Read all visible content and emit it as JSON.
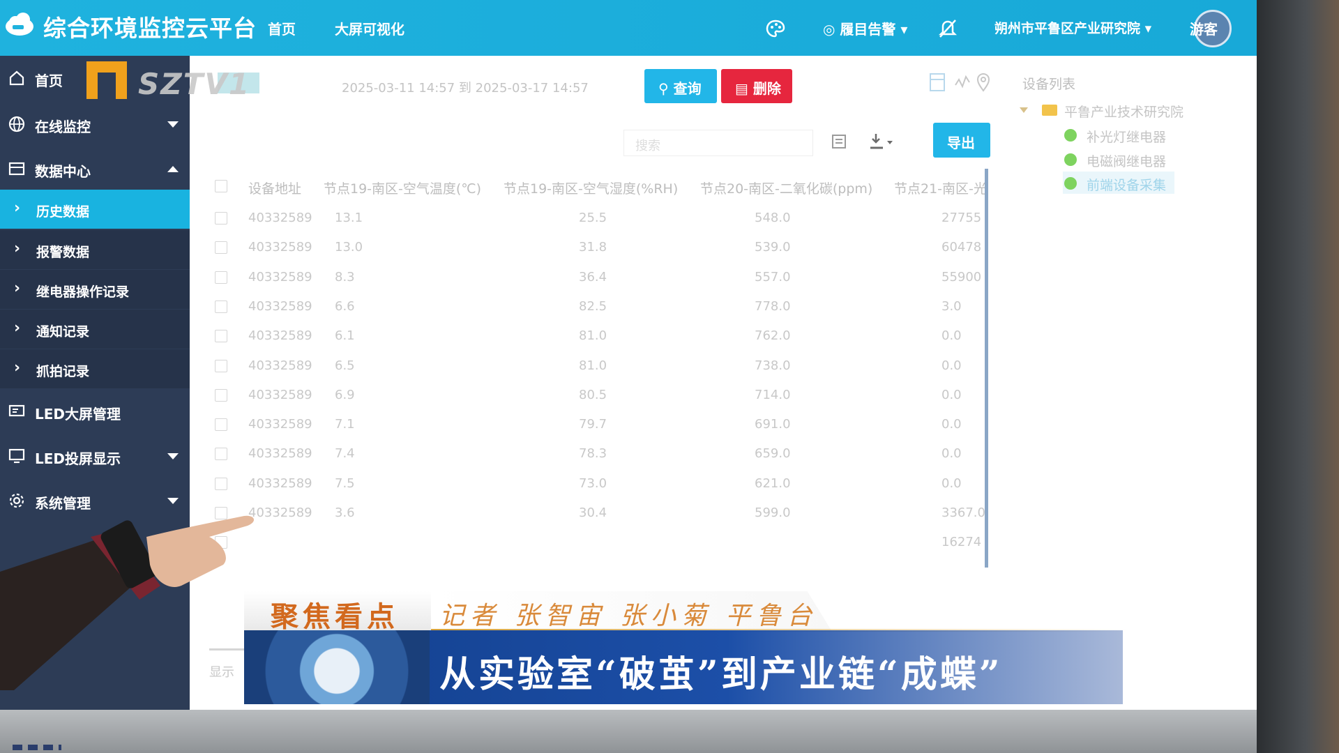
{
  "app": {
    "title": "综合环境监控云平台"
  },
  "topnav": {
    "home": "首页",
    "bigscreen": "大屏可视化",
    "alarm": "履目告警",
    "org": "朔州市平鲁区产业研究院",
    "user": "游客"
  },
  "sidebar": {
    "items": [
      {
        "label": "首页"
      },
      {
        "label": "在线监控"
      },
      {
        "label": "数据中心"
      },
      {
        "label": "LED大屏管理"
      },
      {
        "label": "LED投屏显示"
      },
      {
        "label": "系统管理"
      }
    ],
    "sub": [
      {
        "label": "历史数据"
      },
      {
        "label": "报警数据"
      },
      {
        "label": "继电器操作记录"
      },
      {
        "label": "通知记录"
      },
      {
        "label": "抓拍记录"
      }
    ]
  },
  "watermark": {
    "text": "SZTV1"
  },
  "toolbar": {
    "date_range": "2025-03-11 14:57 到 2025-03-17 14:57",
    "query": "查询",
    "delete": "删除",
    "search_placeholder": "搜索",
    "export": "导出"
  },
  "table": {
    "headers": [
      "设备地址",
      "节点19-南区-空气温度(℃)",
      "节点19-南区-空气湿度(%RH)",
      "节点20-南区-二氧化碳(ppm)",
      "节点21-南区-光"
    ],
    "rows": [
      [
        "40332589",
        "13.1",
        "25.5",
        "548.0",
        "27755"
      ],
      [
        "40332589",
        "13.0",
        "31.8",
        "539.0",
        "60478"
      ],
      [
        "40332589",
        "8.3",
        "36.4",
        "557.0",
        "55900"
      ],
      [
        "40332589",
        "6.6",
        "82.5",
        "778.0",
        "3.0"
      ],
      [
        "40332589",
        "6.1",
        "81.0",
        "762.0",
        "0.0"
      ],
      [
        "40332589",
        "6.5",
        "81.0",
        "738.0",
        "0.0"
      ],
      [
        "40332589",
        "6.9",
        "80.5",
        "714.0",
        "0.0"
      ],
      [
        "40332589",
        "7.1",
        "79.7",
        "691.0",
        "0.0"
      ],
      [
        "40332589",
        "7.4",
        "78.3",
        "659.0",
        "0.0"
      ],
      [
        "40332589",
        "7.5",
        "73.0",
        "621.0",
        "0.0"
      ],
      [
        "40332589",
        "3.6",
        "30.4",
        "599.0",
        "3367.0"
      ],
      [
        "",
        "",
        "",
        "",
        "16274"
      ]
    ],
    "footer": "显示"
  },
  "tree": {
    "title": "设备列表",
    "root": "平鲁产业技术研究院",
    "leaves": [
      "补光灯继电器",
      "电磁阀继电器",
      "前端设备采集"
    ]
  },
  "news": {
    "tag": "聚焦看点",
    "reporters": "记者 张智宙 张小菊 平鲁台",
    "headline": "从实验室“破茧”到产业链“成蝶”"
  },
  "colors": {
    "topbar": "#1fb2de",
    "sidebar": "#2d3c56",
    "accent": "#19b3e0",
    "delete": "#e6263e"
  }
}
